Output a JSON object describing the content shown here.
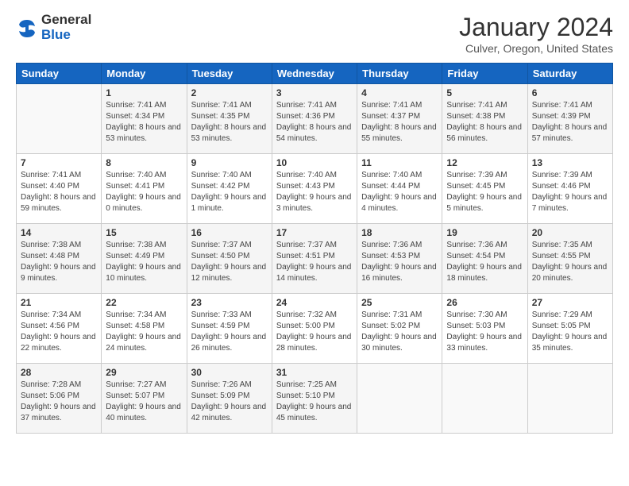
{
  "logo": {
    "general": "General",
    "blue": "Blue"
  },
  "header": {
    "title": "January 2024",
    "subtitle": "Culver, Oregon, United States"
  },
  "weekdays": [
    "Sunday",
    "Monday",
    "Tuesday",
    "Wednesday",
    "Thursday",
    "Friday",
    "Saturday"
  ],
  "weeks": [
    [
      {
        "day": "",
        "sunrise": "",
        "sunset": "",
        "daylight": ""
      },
      {
        "day": "1",
        "sunrise": "Sunrise: 7:41 AM",
        "sunset": "Sunset: 4:34 PM",
        "daylight": "Daylight: 8 hours and 53 minutes."
      },
      {
        "day": "2",
        "sunrise": "Sunrise: 7:41 AM",
        "sunset": "Sunset: 4:35 PM",
        "daylight": "Daylight: 8 hours and 53 minutes."
      },
      {
        "day": "3",
        "sunrise": "Sunrise: 7:41 AM",
        "sunset": "Sunset: 4:36 PM",
        "daylight": "Daylight: 8 hours and 54 minutes."
      },
      {
        "day": "4",
        "sunrise": "Sunrise: 7:41 AM",
        "sunset": "Sunset: 4:37 PM",
        "daylight": "Daylight: 8 hours and 55 minutes."
      },
      {
        "day": "5",
        "sunrise": "Sunrise: 7:41 AM",
        "sunset": "Sunset: 4:38 PM",
        "daylight": "Daylight: 8 hours and 56 minutes."
      },
      {
        "day": "6",
        "sunrise": "Sunrise: 7:41 AM",
        "sunset": "Sunset: 4:39 PM",
        "daylight": "Daylight: 8 hours and 57 minutes."
      }
    ],
    [
      {
        "day": "7",
        "sunrise": "Sunrise: 7:41 AM",
        "sunset": "Sunset: 4:40 PM",
        "daylight": "Daylight: 8 hours and 59 minutes."
      },
      {
        "day": "8",
        "sunrise": "Sunrise: 7:40 AM",
        "sunset": "Sunset: 4:41 PM",
        "daylight": "Daylight: 9 hours and 0 minutes."
      },
      {
        "day": "9",
        "sunrise": "Sunrise: 7:40 AM",
        "sunset": "Sunset: 4:42 PM",
        "daylight": "Daylight: 9 hours and 1 minute."
      },
      {
        "day": "10",
        "sunrise": "Sunrise: 7:40 AM",
        "sunset": "Sunset: 4:43 PM",
        "daylight": "Daylight: 9 hours and 3 minutes."
      },
      {
        "day": "11",
        "sunrise": "Sunrise: 7:40 AM",
        "sunset": "Sunset: 4:44 PM",
        "daylight": "Daylight: 9 hours and 4 minutes."
      },
      {
        "day": "12",
        "sunrise": "Sunrise: 7:39 AM",
        "sunset": "Sunset: 4:45 PM",
        "daylight": "Daylight: 9 hours and 5 minutes."
      },
      {
        "day": "13",
        "sunrise": "Sunrise: 7:39 AM",
        "sunset": "Sunset: 4:46 PM",
        "daylight": "Daylight: 9 hours and 7 minutes."
      }
    ],
    [
      {
        "day": "14",
        "sunrise": "Sunrise: 7:38 AM",
        "sunset": "Sunset: 4:48 PM",
        "daylight": "Daylight: 9 hours and 9 minutes."
      },
      {
        "day": "15",
        "sunrise": "Sunrise: 7:38 AM",
        "sunset": "Sunset: 4:49 PM",
        "daylight": "Daylight: 9 hours and 10 minutes."
      },
      {
        "day": "16",
        "sunrise": "Sunrise: 7:37 AM",
        "sunset": "Sunset: 4:50 PM",
        "daylight": "Daylight: 9 hours and 12 minutes."
      },
      {
        "day": "17",
        "sunrise": "Sunrise: 7:37 AM",
        "sunset": "Sunset: 4:51 PM",
        "daylight": "Daylight: 9 hours and 14 minutes."
      },
      {
        "day": "18",
        "sunrise": "Sunrise: 7:36 AM",
        "sunset": "Sunset: 4:53 PM",
        "daylight": "Daylight: 9 hours and 16 minutes."
      },
      {
        "day": "19",
        "sunrise": "Sunrise: 7:36 AM",
        "sunset": "Sunset: 4:54 PM",
        "daylight": "Daylight: 9 hours and 18 minutes."
      },
      {
        "day": "20",
        "sunrise": "Sunrise: 7:35 AM",
        "sunset": "Sunset: 4:55 PM",
        "daylight": "Daylight: 9 hours and 20 minutes."
      }
    ],
    [
      {
        "day": "21",
        "sunrise": "Sunrise: 7:34 AM",
        "sunset": "Sunset: 4:56 PM",
        "daylight": "Daylight: 9 hours and 22 minutes."
      },
      {
        "day": "22",
        "sunrise": "Sunrise: 7:34 AM",
        "sunset": "Sunset: 4:58 PM",
        "daylight": "Daylight: 9 hours and 24 minutes."
      },
      {
        "day": "23",
        "sunrise": "Sunrise: 7:33 AM",
        "sunset": "Sunset: 4:59 PM",
        "daylight": "Daylight: 9 hours and 26 minutes."
      },
      {
        "day": "24",
        "sunrise": "Sunrise: 7:32 AM",
        "sunset": "Sunset: 5:00 PM",
        "daylight": "Daylight: 9 hours and 28 minutes."
      },
      {
        "day": "25",
        "sunrise": "Sunrise: 7:31 AM",
        "sunset": "Sunset: 5:02 PM",
        "daylight": "Daylight: 9 hours and 30 minutes."
      },
      {
        "day": "26",
        "sunrise": "Sunrise: 7:30 AM",
        "sunset": "Sunset: 5:03 PM",
        "daylight": "Daylight: 9 hours and 33 minutes."
      },
      {
        "day": "27",
        "sunrise": "Sunrise: 7:29 AM",
        "sunset": "Sunset: 5:05 PM",
        "daylight": "Daylight: 9 hours and 35 minutes."
      }
    ],
    [
      {
        "day": "28",
        "sunrise": "Sunrise: 7:28 AM",
        "sunset": "Sunset: 5:06 PM",
        "daylight": "Daylight: 9 hours and 37 minutes."
      },
      {
        "day": "29",
        "sunrise": "Sunrise: 7:27 AM",
        "sunset": "Sunset: 5:07 PM",
        "daylight": "Daylight: 9 hours and 40 minutes."
      },
      {
        "day": "30",
        "sunrise": "Sunrise: 7:26 AM",
        "sunset": "Sunset: 5:09 PM",
        "daylight": "Daylight: 9 hours and 42 minutes."
      },
      {
        "day": "31",
        "sunrise": "Sunrise: 7:25 AM",
        "sunset": "Sunset: 5:10 PM",
        "daylight": "Daylight: 9 hours and 45 minutes."
      },
      {
        "day": "",
        "sunrise": "",
        "sunset": "",
        "daylight": ""
      },
      {
        "day": "",
        "sunrise": "",
        "sunset": "",
        "daylight": ""
      },
      {
        "day": "",
        "sunrise": "",
        "sunset": "",
        "daylight": ""
      }
    ]
  ]
}
